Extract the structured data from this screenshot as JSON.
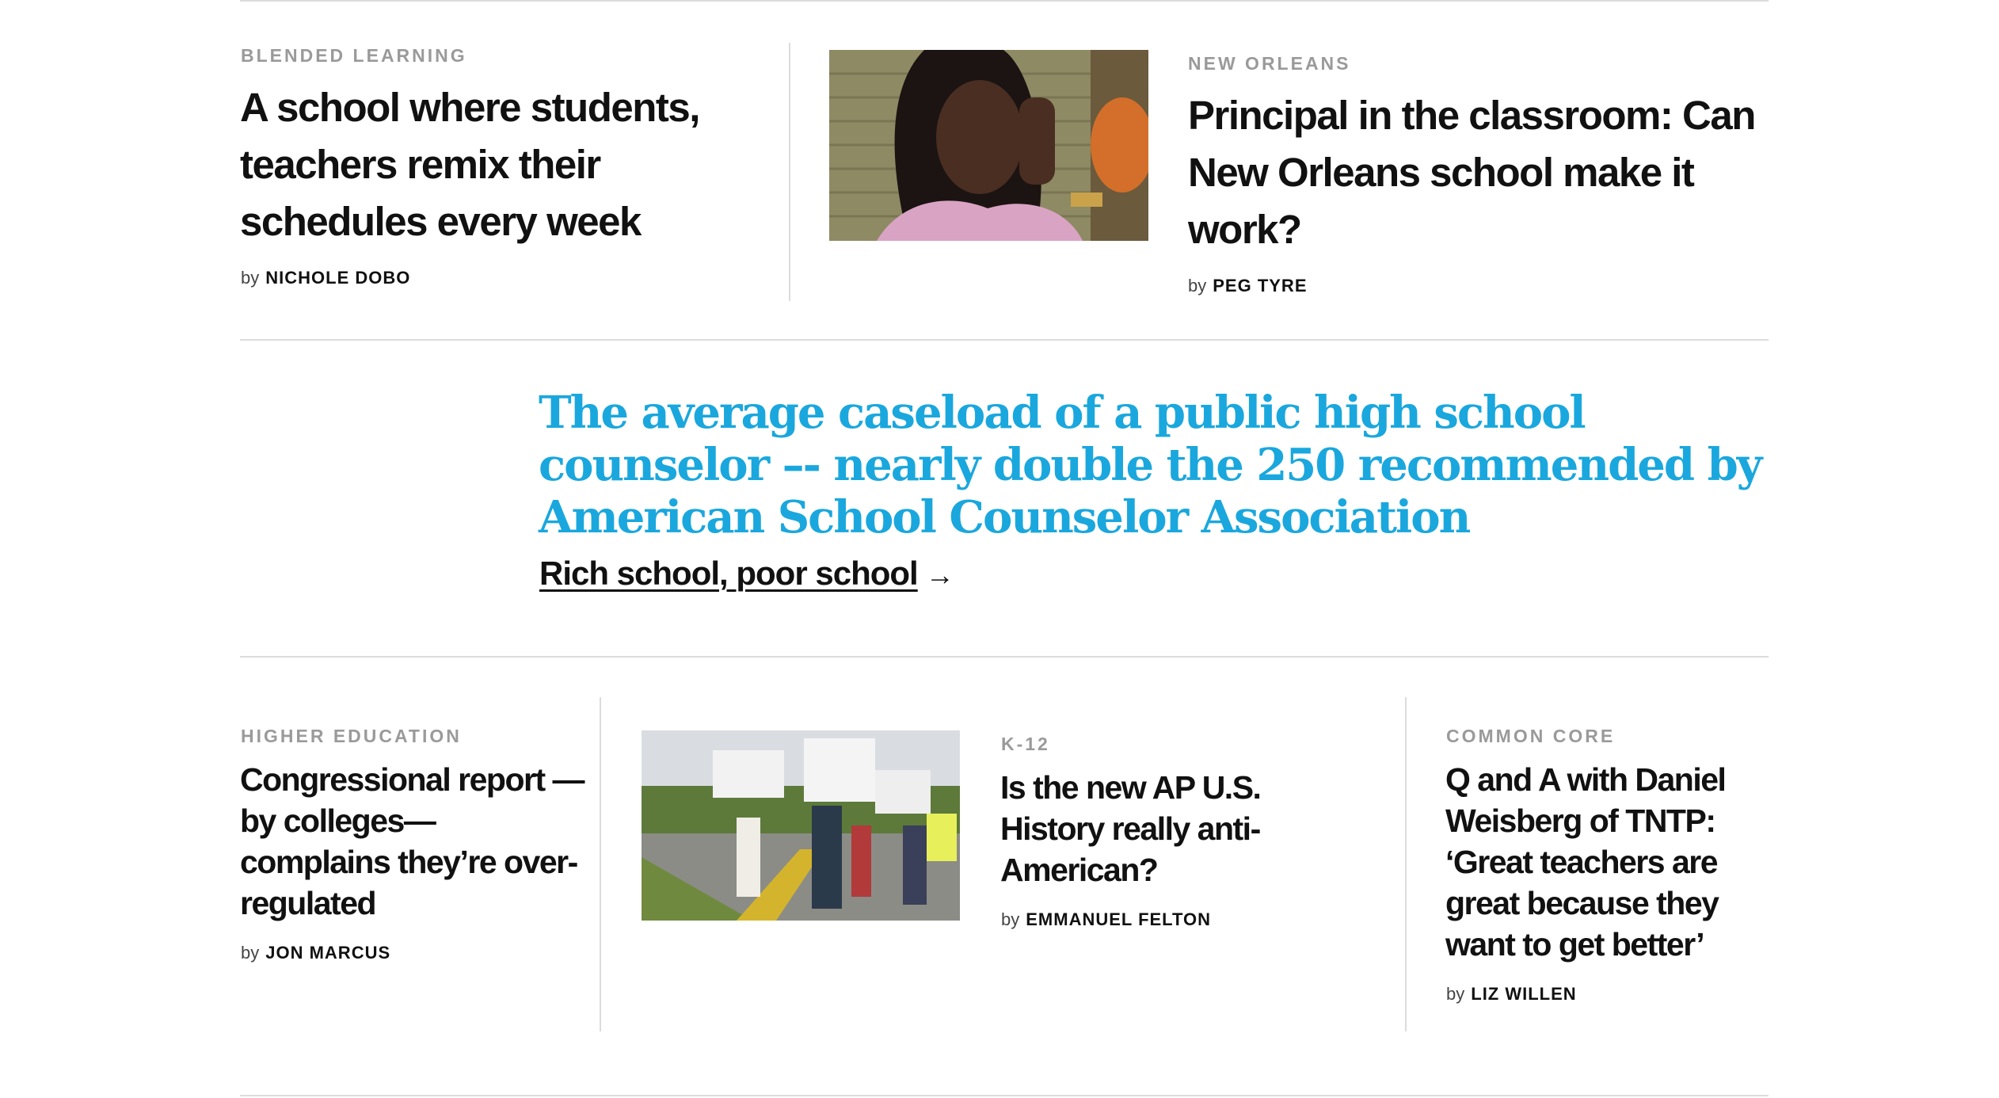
{
  "top_row": {
    "left": {
      "kicker": "BLENDED LEARNING",
      "headline": "A school where students, teachers remix their schedules every week",
      "by": "by",
      "author": "NICHOLE DOBO"
    },
    "right": {
      "kicker": "NEW ORLEANS",
      "headline": "Principal in the classroom: Can New Orleans school make it work?",
      "by": "by",
      "author": "PEG TYRE"
    }
  },
  "callout": {
    "quote": "The average caseload of a public high school counselor –- nearly double the 250 recommended by American School Counselor Association",
    "link_text": "Rich school, poor school",
    "arrow": "→"
  },
  "bottom_row": {
    "col1": {
      "kicker": "HIGHER EDUCATION",
      "headline": "Congressional report —by colleges— complains they’re over-regulated",
      "by": "by",
      "author": "JON MARCUS"
    },
    "col2": {
      "kicker": "K-12",
      "headline": "Is the new AP U.S. History really anti-American?",
      "by": "by",
      "author": "EMMANUEL FELTON"
    },
    "col3": {
      "kicker": "COMMON CORE",
      "headline": "Q and A with Daniel Weisberg of TNTP: ‘Great teachers are great because they want to get better’",
      "by": "by",
      "author": "LIZ WILLEN"
    }
  },
  "colors": {
    "accent": "#1aa7dd",
    "kicker": "#9a9a9a",
    "rule": "#dcdcdc",
    "text": "#111111"
  }
}
